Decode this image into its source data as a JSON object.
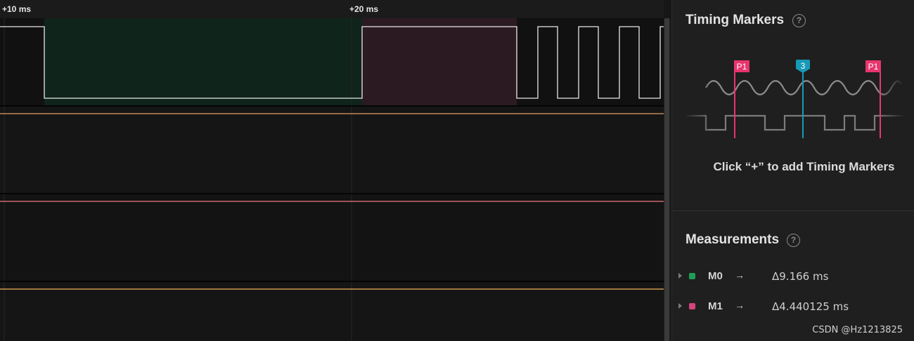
{
  "time_ruler": {
    "labels": [
      "+10 ms",
      "+20 ms"
    ]
  },
  "timing_markers": {
    "title": "Timing Markers",
    "help": "?",
    "marker_tags": [
      "P1",
      "3",
      "P1"
    ],
    "hint": "Click “+” to add Timing Markers"
  },
  "measurements": {
    "title": "Measurements",
    "help": "?",
    "items": [
      {
        "name": "M0",
        "arrow": "→",
        "value": "Δ9.166 ms",
        "color": "#1f9d55"
      },
      {
        "name": "M1",
        "arrow": "→",
        "value": "Δ4.440125 ms",
        "color": "#d4447e"
      }
    ]
  },
  "watermark": "CSDN @Hz1213825",
  "colors": {
    "measure_green": "#0f241b",
    "measure_pink": "#2c1a23",
    "channel_orange": "#e0a063",
    "channel_red": "#f07a7e",
    "channel_yellow": "#f2b45a",
    "marker_pink": "#e8356f",
    "marker_teal": "#1799b8"
  }
}
